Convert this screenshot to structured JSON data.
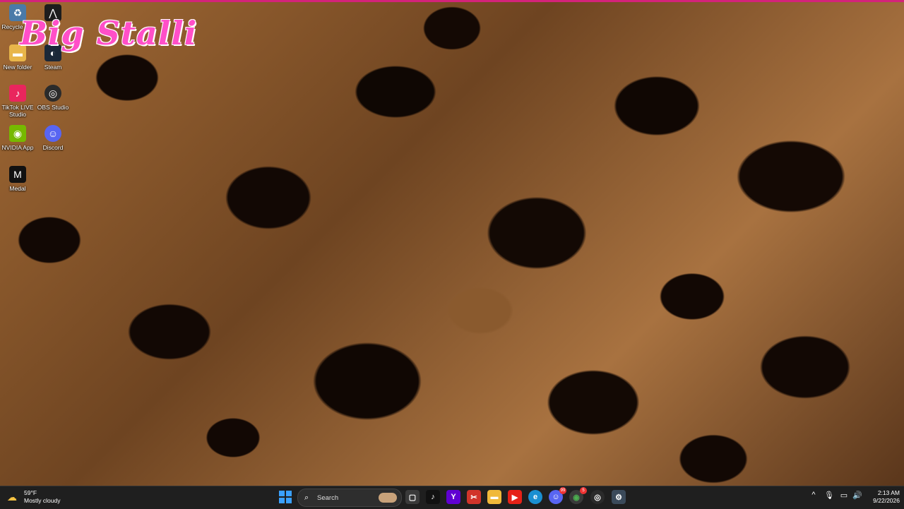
{
  "desktop": {
    "icons": [
      {
        "label": "Recycle B...",
        "icon": "recycle-bin-icon"
      },
      {
        "label": "New folder",
        "icon": "folder-icon"
      },
      {
        "label": "Steam",
        "icon": "steam-icon"
      },
      {
        "label": "TikTok LIVE Studio",
        "icon": "tiktok-live-icon"
      },
      {
        "label": "OBS Studio",
        "icon": "obs-icon"
      },
      {
        "label": "NVIDIA App",
        "icon": "nvidia-icon"
      },
      {
        "label": "Discord",
        "icon": "discord-icon"
      },
      {
        "label": "Medal",
        "icon": "medal-icon"
      }
    ]
  },
  "wallpaper": {
    "overlay_text": "Big Stalli"
  },
  "taskbar": {
    "weather": {
      "temp": "59°F",
      "condition": "Mostly cloudy"
    },
    "search": {
      "placeholder": "Search"
    },
    "apps": [
      {
        "name": "task-view",
        "glyph": "▢"
      },
      {
        "name": "tiktok",
        "glyph": "♪"
      },
      {
        "name": "yahoo",
        "glyph": "Y"
      },
      {
        "name": "snipping-tool",
        "glyph": "✂"
      },
      {
        "name": "file-explorer",
        "glyph": "▬"
      },
      {
        "name": "youtube",
        "glyph": "▶"
      },
      {
        "name": "edge",
        "glyph": "e"
      },
      {
        "name": "discord",
        "glyph": "☺",
        "badge": "99"
      },
      {
        "name": "chrome",
        "glyph": "◉",
        "badge": "5"
      },
      {
        "name": "obs",
        "glyph": "◎"
      },
      {
        "name": "settings",
        "glyph": "⚙"
      }
    ],
    "tray": {
      "chevron": "^",
      "mic": "🎙",
      "display": "▭",
      "volume": "🔊"
    },
    "clock": {
      "time": "2:13 AM",
      "date": "9/22/2026"
    }
  },
  "colors": {
    "accent": "#d4237a",
    "brand_pink": "#ff4fc8",
    "taskbar_bg": "#1f1f1f"
  }
}
